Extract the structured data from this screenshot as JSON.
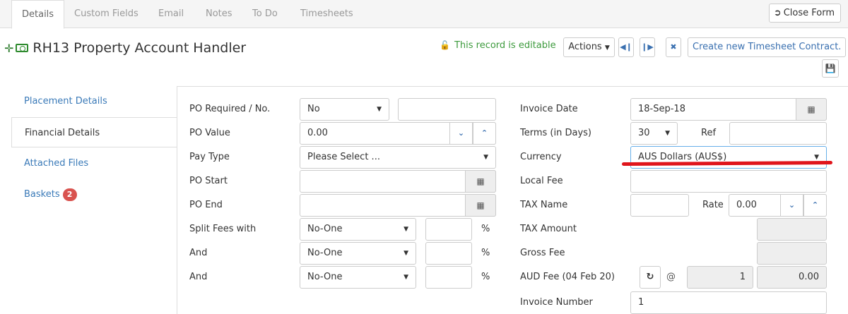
{
  "tabs": [
    {
      "label": "Details"
    },
    {
      "label": "Custom Fields"
    },
    {
      "label": "Email"
    },
    {
      "label": "Notes"
    },
    {
      "label": "To Do"
    },
    {
      "label": "Timesheets"
    }
  ],
  "close_form_label": "Close Form",
  "page_title": "RH13 Property Account Handler",
  "editable_text": "This record is editable",
  "actions_label": "Actions",
  "create_timesheet_label": "Create new Timesheet Contract.",
  "sidebar": {
    "items": [
      {
        "label": "Placement Details"
      },
      {
        "label": "Financial Details"
      },
      {
        "label": "Attached Files"
      },
      {
        "label": "Baskets",
        "badge": "2"
      }
    ]
  },
  "form": {
    "po_required": {
      "label": "PO Required / No.",
      "value": "No",
      "number": ""
    },
    "po_value": {
      "label": "PO Value",
      "value": "0.00"
    },
    "pay_type": {
      "label": "Pay Type",
      "placeholder": "Please Select ..."
    },
    "po_start": {
      "label": "PO Start",
      "value": ""
    },
    "po_end": {
      "label": "PO End",
      "value": ""
    },
    "split_fees": {
      "label": "Split Fees with",
      "value": "No-One",
      "pct": "",
      "pct_symbol": "%"
    },
    "and1": {
      "label": "And",
      "value": "No-One",
      "pct": "",
      "pct_symbol": "%"
    },
    "and2": {
      "label": "And",
      "value": "No-One",
      "pct": "",
      "pct_symbol": "%"
    },
    "invoice_date": {
      "label": "Invoice Date",
      "value": "18-Sep-18"
    },
    "terms": {
      "label": "Terms (in Days)",
      "value": "30",
      "ref_label": "Ref",
      "ref_value": ""
    },
    "currency": {
      "label": "Currency",
      "value": "AUS Dollars (AUS$)"
    },
    "local_fee": {
      "label": "Local Fee",
      "value": ""
    },
    "tax_name": {
      "label": "TAX Name",
      "value": "",
      "rate_label": "Rate",
      "rate_value": "0.00"
    },
    "tax_amount": {
      "label": "TAX Amount",
      "value": ""
    },
    "gross_fee": {
      "label": "Gross Fee",
      "value": ""
    },
    "aud_fee": {
      "label": "AUD Fee (04 Feb 20)",
      "at_symbol": "@",
      "rate": "1",
      "value": "0.00"
    },
    "invoice_number": {
      "label": "Invoice Number",
      "value": "1"
    }
  },
  "colors": {
    "accent": "#3a70b0",
    "editable": "#3c9a3c",
    "badge": "#d9534f",
    "annotation": "#e0151b"
  }
}
